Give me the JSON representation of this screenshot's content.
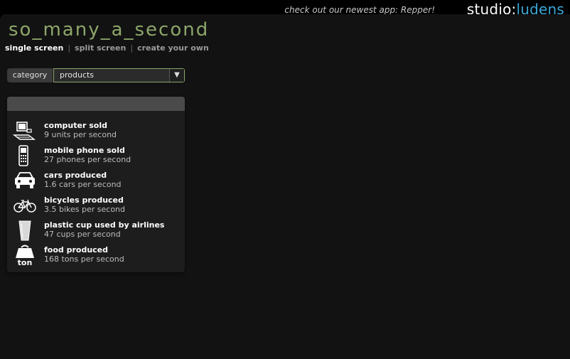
{
  "header": {
    "promo_text": "check out our newest app: Repper!",
    "brand_part1": "studio:",
    "brand_part2": "ludens"
  },
  "app": {
    "title": "so_many_a_second"
  },
  "nav": {
    "items": [
      {
        "label": "single screen",
        "active": true
      },
      {
        "label": "split screen",
        "active": false
      },
      {
        "label": "create your own",
        "active": false
      }
    ]
  },
  "category": {
    "label": "category",
    "value": "products"
  },
  "list": {
    "items": [
      {
        "icon": "computer-icon",
        "name": "computer sold",
        "rate": "9 units per second"
      },
      {
        "icon": "mobile-phone-icon",
        "name": "mobile phone sold",
        "rate": "27 phones per second"
      },
      {
        "icon": "car-icon",
        "name": "cars produced",
        "rate": "1.6 cars per second"
      },
      {
        "icon": "bicycle-icon",
        "name": "bicycles produced",
        "rate": "3.5 bikes per second"
      },
      {
        "icon": "plastic-cup-icon",
        "name": "plastic cup used by airlines",
        "rate": "47 cups per second"
      },
      {
        "icon": "weight-ton-icon",
        "name": "food produced",
        "rate": "168 tons per second",
        "icon_text": "ton"
      }
    ]
  },
  "colors": {
    "accent": "#8da66a",
    "brand_blue": "#3aa7d6",
    "panel": "#121212"
  }
}
